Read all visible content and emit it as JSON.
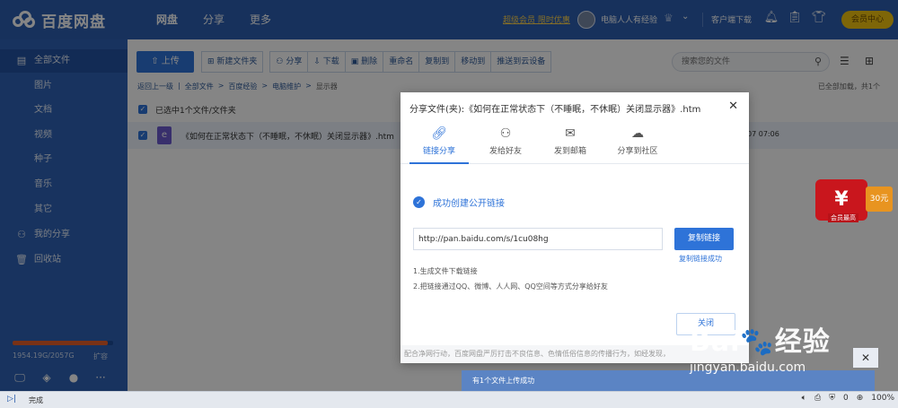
{
  "app": {
    "logo_text": "百度网盘",
    "nav": [
      "网盘",
      "分享",
      "更多"
    ],
    "vip_link": "超级会员 限时优惠",
    "username": "电脑人人有经验",
    "client_download": "客户端下载",
    "member_center": "会员中心"
  },
  "sidebar": {
    "items": [
      {
        "label": "全部文件",
        "icon": "files-icon"
      },
      {
        "label": "图片"
      },
      {
        "label": "文档"
      },
      {
        "label": "视频"
      },
      {
        "label": "种子"
      },
      {
        "label": "音乐"
      },
      {
        "label": "其它"
      },
      {
        "label": "我的分享",
        "icon": "share-icon"
      },
      {
        "label": "回收站",
        "icon": "trash-icon"
      }
    ],
    "quota_text": "1954.19G/2057G",
    "quota_used_fraction": 0.95,
    "expand_label": "扩容"
  },
  "toolbar": {
    "upload": "上传",
    "new_folder": "新建文件夹",
    "share": "分享",
    "download": "下载",
    "delete": "删除",
    "rename": "重命名",
    "copy_to": "复制到",
    "move_to": "移动到",
    "push_to_cloud": "推送到云设备",
    "search_placeholder": "搜索您的文件"
  },
  "breadcrumb": {
    "back": "返回上一级",
    "all_files": "全部文件",
    "folder1": "百度经验",
    "folder2": "电脑维护",
    "current": "显示器",
    "loaded_status": "已全部加载，共1个"
  },
  "file_list": {
    "selection_text": "已选中1个文件/文件夹",
    "file_name": "《如何在正常状态下（不睡眠，不休眠）关闭显示器》.htm",
    "file_time": "07 07:06"
  },
  "promo": {
    "badge": "30元",
    "sub": "会员最高"
  },
  "dialog": {
    "title": "分享文件(夹):《如何在正常状态下（不睡眠，不休眠）关闭显示器》.htm",
    "tabs": [
      "链接分享",
      "发给好友",
      "发到邮箱",
      "分享到社区"
    ],
    "success_text": "成功创建公开链接",
    "link_url": "http://pan.baidu.com/s/1cu08hg",
    "copy_button": "复制链接",
    "copied_text": "复制链接成功",
    "tip1": "1.生成文件下载链接",
    "tip2": "2.把链接通过QQ、微博、人人网、QQ空间等方式分享给好友",
    "close_button": "关闭",
    "footer": "配合净网行动，百度网盘严厉打击不良信息、色情低俗信息的传播行为，如经发现，"
  },
  "notice": {
    "text": "有1个文件上传成功"
  },
  "watermark": {
    "logo": "Bai🐾经验",
    "url": "jingyan.baidu.com"
  },
  "statusbar": {
    "status": "完成",
    "count": "0",
    "zoom": "100%"
  }
}
